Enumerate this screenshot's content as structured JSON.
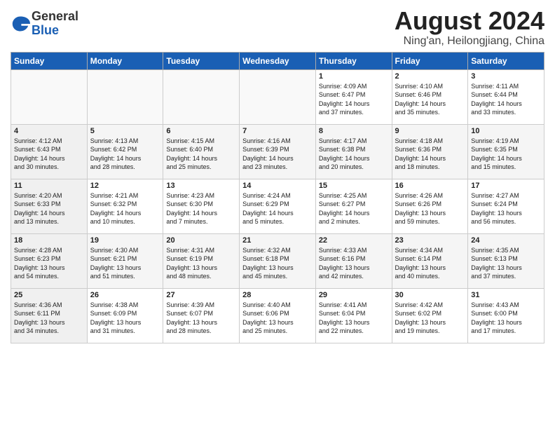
{
  "header": {
    "logo_general": "General",
    "logo_blue": "Blue",
    "month_title": "August 2024",
    "location": "Ning'an, Heilongjiang, China"
  },
  "days_of_week": [
    "Sunday",
    "Monday",
    "Tuesday",
    "Wednesday",
    "Thursday",
    "Friday",
    "Saturday"
  ],
  "weeks": [
    [
      {
        "day": "",
        "info": ""
      },
      {
        "day": "",
        "info": ""
      },
      {
        "day": "",
        "info": ""
      },
      {
        "day": "",
        "info": ""
      },
      {
        "day": "1",
        "info": "Sunrise: 4:09 AM\nSunset: 6:47 PM\nDaylight: 14 hours\nand 37 minutes."
      },
      {
        "day": "2",
        "info": "Sunrise: 4:10 AM\nSunset: 6:46 PM\nDaylight: 14 hours\nand 35 minutes."
      },
      {
        "day": "3",
        "info": "Sunrise: 4:11 AM\nSunset: 6:44 PM\nDaylight: 14 hours\nand 33 minutes."
      }
    ],
    [
      {
        "day": "4",
        "info": "Sunrise: 4:12 AM\nSunset: 6:43 PM\nDaylight: 14 hours\nand 30 minutes."
      },
      {
        "day": "5",
        "info": "Sunrise: 4:13 AM\nSunset: 6:42 PM\nDaylight: 14 hours\nand 28 minutes."
      },
      {
        "day": "6",
        "info": "Sunrise: 4:15 AM\nSunset: 6:40 PM\nDaylight: 14 hours\nand 25 minutes."
      },
      {
        "day": "7",
        "info": "Sunrise: 4:16 AM\nSunset: 6:39 PM\nDaylight: 14 hours\nand 23 minutes."
      },
      {
        "day": "8",
        "info": "Sunrise: 4:17 AM\nSunset: 6:38 PM\nDaylight: 14 hours\nand 20 minutes."
      },
      {
        "day": "9",
        "info": "Sunrise: 4:18 AM\nSunset: 6:36 PM\nDaylight: 14 hours\nand 18 minutes."
      },
      {
        "day": "10",
        "info": "Sunrise: 4:19 AM\nSunset: 6:35 PM\nDaylight: 14 hours\nand 15 minutes."
      }
    ],
    [
      {
        "day": "11",
        "info": "Sunrise: 4:20 AM\nSunset: 6:33 PM\nDaylight: 14 hours\nand 13 minutes."
      },
      {
        "day": "12",
        "info": "Sunrise: 4:21 AM\nSunset: 6:32 PM\nDaylight: 14 hours\nand 10 minutes."
      },
      {
        "day": "13",
        "info": "Sunrise: 4:23 AM\nSunset: 6:30 PM\nDaylight: 14 hours\nand 7 minutes."
      },
      {
        "day": "14",
        "info": "Sunrise: 4:24 AM\nSunset: 6:29 PM\nDaylight: 14 hours\nand 5 minutes."
      },
      {
        "day": "15",
        "info": "Sunrise: 4:25 AM\nSunset: 6:27 PM\nDaylight: 14 hours\nand 2 minutes."
      },
      {
        "day": "16",
        "info": "Sunrise: 4:26 AM\nSunset: 6:26 PM\nDaylight: 13 hours\nand 59 minutes."
      },
      {
        "day": "17",
        "info": "Sunrise: 4:27 AM\nSunset: 6:24 PM\nDaylight: 13 hours\nand 56 minutes."
      }
    ],
    [
      {
        "day": "18",
        "info": "Sunrise: 4:28 AM\nSunset: 6:23 PM\nDaylight: 13 hours\nand 54 minutes."
      },
      {
        "day": "19",
        "info": "Sunrise: 4:30 AM\nSunset: 6:21 PM\nDaylight: 13 hours\nand 51 minutes."
      },
      {
        "day": "20",
        "info": "Sunrise: 4:31 AM\nSunset: 6:19 PM\nDaylight: 13 hours\nand 48 minutes."
      },
      {
        "day": "21",
        "info": "Sunrise: 4:32 AM\nSunset: 6:18 PM\nDaylight: 13 hours\nand 45 minutes."
      },
      {
        "day": "22",
        "info": "Sunrise: 4:33 AM\nSunset: 6:16 PM\nDaylight: 13 hours\nand 42 minutes."
      },
      {
        "day": "23",
        "info": "Sunrise: 4:34 AM\nSunset: 6:14 PM\nDaylight: 13 hours\nand 40 minutes."
      },
      {
        "day": "24",
        "info": "Sunrise: 4:35 AM\nSunset: 6:13 PM\nDaylight: 13 hours\nand 37 minutes."
      }
    ],
    [
      {
        "day": "25",
        "info": "Sunrise: 4:36 AM\nSunset: 6:11 PM\nDaylight: 13 hours\nand 34 minutes."
      },
      {
        "day": "26",
        "info": "Sunrise: 4:38 AM\nSunset: 6:09 PM\nDaylight: 13 hours\nand 31 minutes."
      },
      {
        "day": "27",
        "info": "Sunrise: 4:39 AM\nSunset: 6:07 PM\nDaylight: 13 hours\nand 28 minutes."
      },
      {
        "day": "28",
        "info": "Sunrise: 4:40 AM\nSunset: 6:06 PM\nDaylight: 13 hours\nand 25 minutes."
      },
      {
        "day": "29",
        "info": "Sunrise: 4:41 AM\nSunset: 6:04 PM\nDaylight: 13 hours\nand 22 minutes."
      },
      {
        "day": "30",
        "info": "Sunrise: 4:42 AM\nSunset: 6:02 PM\nDaylight: 13 hours\nand 19 minutes."
      },
      {
        "day": "31",
        "info": "Sunrise: 4:43 AM\nSunset: 6:00 PM\nDaylight: 13 hours\nand 17 minutes."
      }
    ]
  ]
}
